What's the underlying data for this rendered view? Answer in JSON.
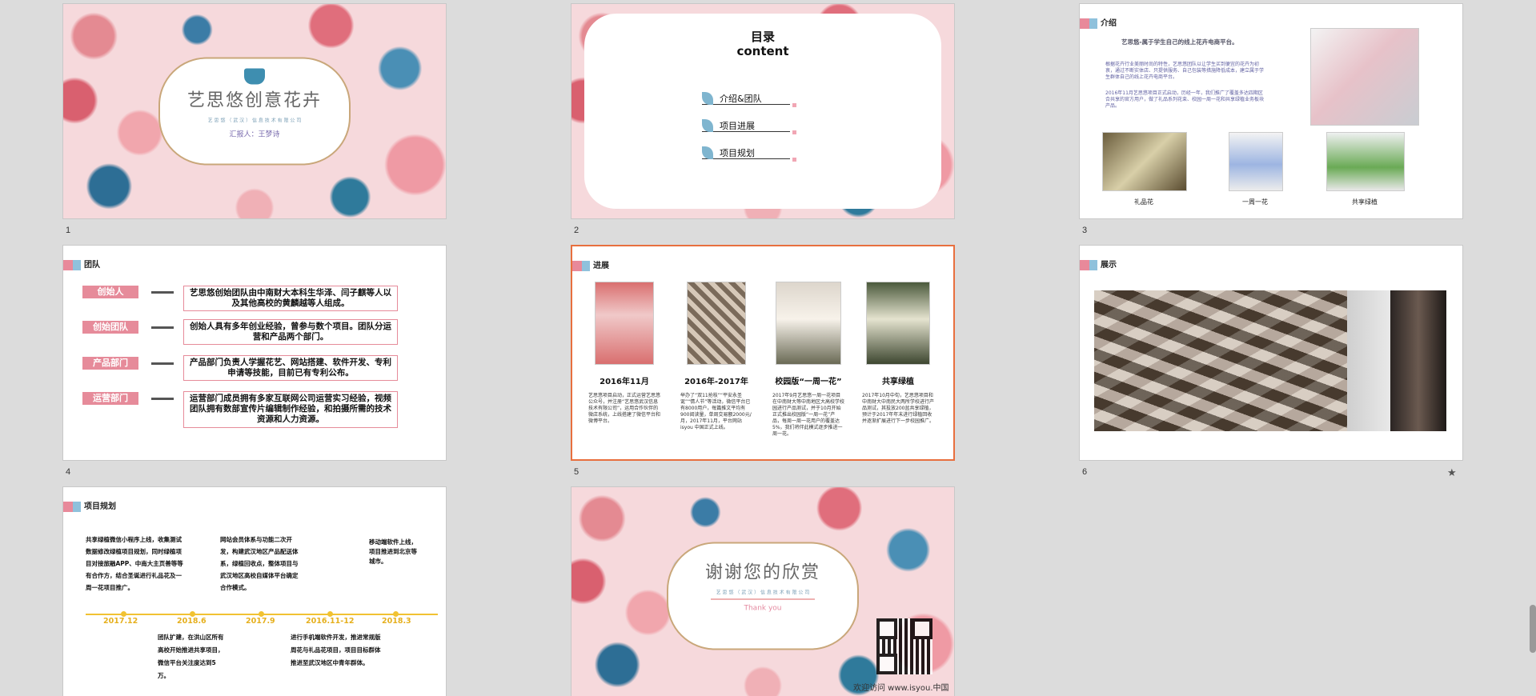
{
  "slides": [
    {
      "num": "1",
      "title": "艺思悠创意花卉",
      "subtitle": "艺 思 悠 （ 武 汉 ） 信 息 技 术 有 限 公 司",
      "reporter": "汇报人：王梦诗"
    },
    {
      "num": "2",
      "title1": "目录",
      "title2": "content",
      "items": [
        "介绍&团队",
        "项目进展",
        "项目规划"
      ]
    },
    {
      "num": "3",
      "header": "介绍",
      "headline": "艺思悠-属于学生自己的线上花卉电商平台。",
      "para1": "根据花卉行业美丽时尚的特性，艺思悠团队以让学生买到便宜的花卉为初衷，通过不断实体店、只提供服务、自己包装等措施降低成本，建立属于学生群体自己的线上花卉电商平台。",
      "para2": "2016年11月艺思悠项目正式启动，历经一年，我们推广了覆盖多达四期区合共享的官方用户，做了礼品系列花束、校园一周一花和共享绿植业务板块产品。",
      "captions": [
        "礼品花",
        "一周一花",
        "共享绿植"
      ]
    },
    {
      "num": "4",
      "header": "团队",
      "roles": [
        {
          "label": "创始人",
          "desc": "艺思悠创始团队由中南财大本科生华泽、闫子麒等人以及其他高校的黄麟越等人组成。"
        },
        {
          "label": "创始团队",
          "desc": "创始人具有多年创业经验，曾参与数个项目。团队分运营和产品两个部门。"
        },
        {
          "label": "产品部门",
          "desc": "产品部门负责人学握花艺、网站搭建、软件开发、专利申请等技能，目前已有专利公布。"
        },
        {
          "label": "运营部门",
          "desc": "运营部门成员拥有多家互联网公司运营实习经验，视频团队拥有数部宣传片编辑制作经验，和拍摄所需的技术资源和人力资源。"
        }
      ]
    },
    {
      "num": "5",
      "header": "进展",
      "cols": [
        {
          "year": "2016年11月",
          "text": "艺思悠项目启动，正式运营艺思悠公众号，并注册“艺思悠武汉信息技术有限公司”，运用合作伙伴的微店系统，上线搭建了微信平台和微博平台。"
        },
        {
          "year": "2016年-2017年",
          "text": "举办了“双11抢枝”“平安永圣诞”“情人节”等活动，微信平台已有8000用户，每篇推文平均有900阅读量，单周交易额2000元/月，2017年11月，平台网站isyou 中国正式上线。"
        },
        {
          "year": "校园版“一周一花”",
          "text": "2017年9月艺思悠一周一花项目在中南财大等中南地区大高校学校园进行产品测试，并于10月开始正式推出校园版“一周一花”产品，每周一周一花用户的覆盖达5%，我们将伴此模式逐步推进一周一花。"
        },
        {
          "year": "共享绿植",
          "text": "2017年10月中旬，艺思悠项目和中南财大中南民大两所学校进行产品测试，其投放200盆共享绿植，预计于2017年年末进行绿植回收并逐渐扩展进行下一步校园推广。"
        }
      ]
    },
    {
      "num": "6",
      "header": "展示"
    },
    {
      "num": "",
      "header": "项目规划",
      "top": [
        "共享绿植微信小程序上线，收集测试数据修改绿植项目规划，同时绿植项目对接旅融APP、中南大主页善等等有合作方，结合圣诞进行礼品花及一周一花项目推广。",
        "网站会员体系与功能二次开发，构建武汉地区产品配送体系，绿植回收点，整体项目与武汉地区高校自媒体平台确定合作模式。",
        "移动端软件上线，项目推进到北京等城市。"
      ],
      "dates": [
        "2017.12",
        "2018.6",
        "2017.9",
        "2016.11-12",
        "2018.3"
      ],
      "bottom": [
        "团队扩建，在洪山区所有高校开始推进共享项目，微信平台关注度达到5万。",
        "进行手机端软件开发，推进常规版周花与礼品花项目，项目目标群体推进至武汉地区中青年群体。"
      ]
    },
    {
      "num": "",
      "title": "谢谢您的欣赏",
      "subtitle": "艺 思 悠 （ 武 汉 ） 信 息 技 术 有 限 公 司",
      "thanks": "Thank you",
      "footer": "欢迎访问 www.isyou.中国"
    }
  ],
  "colors": {
    "pink": "#e68b9a",
    "blue": "#8fc1dc",
    "selected": "#e86f3e",
    "timeline": "#f1c232"
  },
  "icons": {
    "star": "★"
  }
}
